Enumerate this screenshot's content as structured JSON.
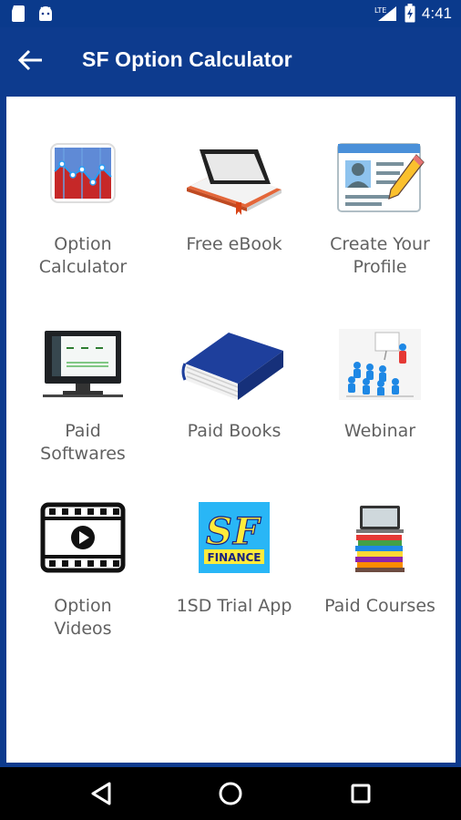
{
  "status_bar": {
    "time": "4:41",
    "network": "LTE",
    "icons": [
      "sd-card-icon",
      "android-icon",
      "lte-signal-icon",
      "battery-icon"
    ]
  },
  "app_bar": {
    "title": "SF Option Calculator",
    "back_icon": "arrow-left-icon"
  },
  "colors": {
    "primary": "#0d3b8e",
    "background": "#ffffff",
    "label_text": "#616161",
    "nav_bar": "#000000"
  },
  "tiles": [
    {
      "label": "Option\nCalculator",
      "icon": "option-calculator-icon"
    },
    {
      "label": "Free eBook",
      "icon": "ebook-reader-icon"
    },
    {
      "label": "Create Your\nProfile",
      "icon": "profile-form-icon"
    },
    {
      "label": "Paid\nSoftwares",
      "icon": "monitor-software-icon"
    },
    {
      "label": "Paid Books",
      "icon": "blue-book-icon"
    },
    {
      "label": "Webinar",
      "icon": "webinar-presentation-icon"
    },
    {
      "label": "Option\nVideos",
      "icon": "film-play-icon"
    },
    {
      "label": "1SD Trial App",
      "icon": "sf-finance-logo-icon"
    },
    {
      "label": "Paid Courses",
      "icon": "laptop-books-icon"
    }
  ],
  "nav_bar": {
    "buttons": [
      "back-triangle-icon",
      "home-circle-icon",
      "recents-square-icon"
    ]
  }
}
